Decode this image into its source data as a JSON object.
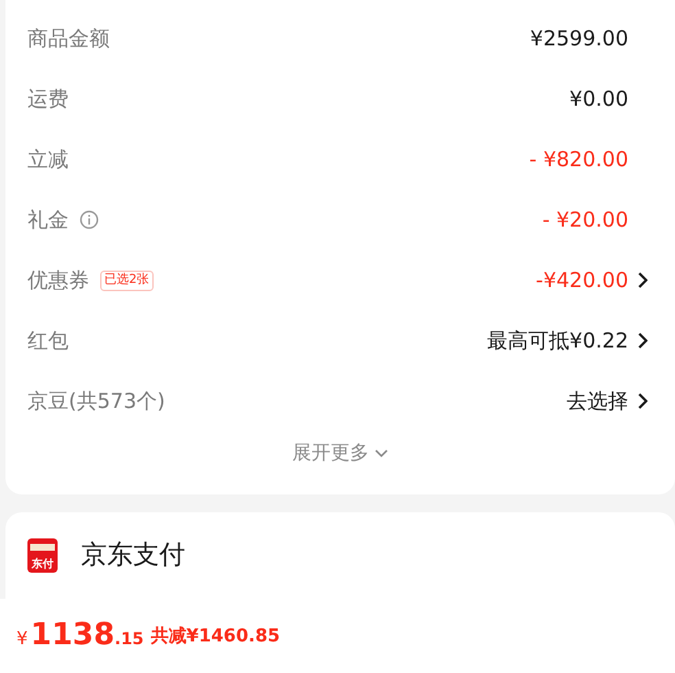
{
  "summary_rows": [
    {
      "label": "商品金额",
      "value": "¥2599.00",
      "color": "#1a1a1a",
      "info": false,
      "chevron": false
    },
    {
      "label": "运费",
      "value": "¥0.00",
      "color": "#1a1a1a",
      "info": false,
      "chevron": false
    },
    {
      "label": "立减",
      "value": "- ¥820.00",
      "color": "#fa2c19",
      "info": false,
      "chevron": false
    },
    {
      "label": "礼金",
      "value": "- ¥20.00",
      "color": "#fa2c19",
      "info": true,
      "chevron": false
    },
    {
      "label": "优惠券",
      "badge": "已选2张",
      "value": "-¥420.00",
      "color": "#fa2c19",
      "info": false,
      "chevron": true
    },
    {
      "label": "红包",
      "value": "最高可抵¥0.22",
      "color": "#1a1a1a",
      "info": false,
      "chevron": true
    },
    {
      "label": "京豆(共573个)",
      "value": "去选择",
      "color": "#1a1a1a",
      "info": false,
      "chevron": true
    }
  ],
  "expand_more": "展开更多",
  "payment": {
    "logo_text": "东付",
    "name": "京东支付"
  },
  "footer": {
    "currency": "¥",
    "total_integer": "1138",
    "total_decimal": ".15",
    "saved": "共减¥1460.85"
  }
}
